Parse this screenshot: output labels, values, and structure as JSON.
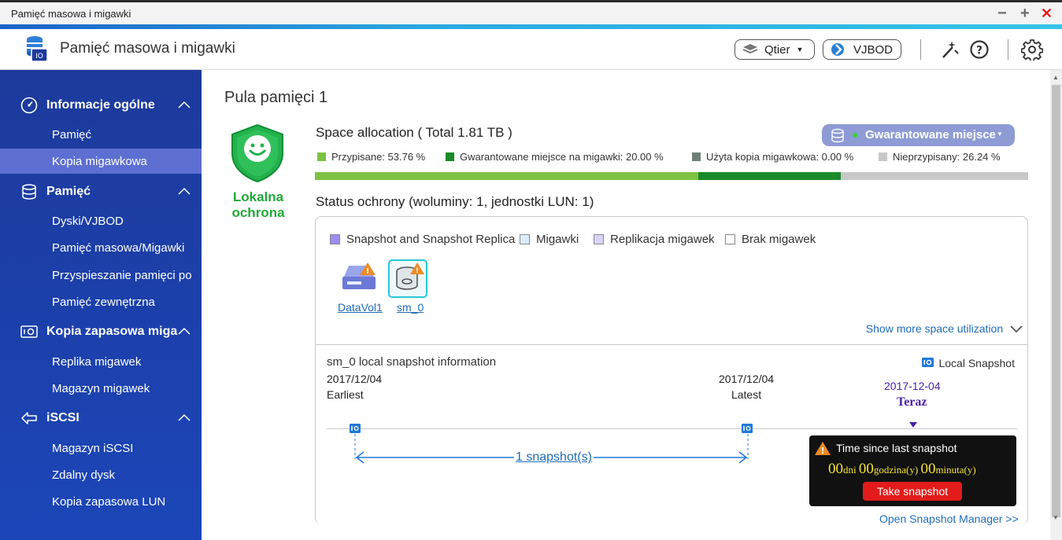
{
  "window": {
    "title": "Pamięć masowa i migawki",
    "controls": {
      "minimize": "−",
      "maximize": "+",
      "close": "✕"
    }
  },
  "header": {
    "app_title": "Pamięć masowa i migawki",
    "qtier_label": "Qtier",
    "vjbod_label": "VJBOD"
  },
  "sidebar": {
    "sections": [
      {
        "label": "Informacje ogólne",
        "items": [
          "Pamięć",
          "Kopia migawkowa"
        ]
      },
      {
        "label": "Pamięć",
        "items": [
          "Dyski/VJBOD",
          "Pamięć masowa/Migawki",
          "Przyspieszanie pamięci po",
          "Pamięć zewnętrzna"
        ]
      },
      {
        "label": "Kopia zapasowa miga",
        "items": [
          "Replika migawek",
          "Magazyn migawek"
        ]
      },
      {
        "label": "iSCSI",
        "items": [
          "Magazyn iSCSI",
          "Zdalny dysk",
          "Kopia zapasowa LUN"
        ]
      }
    ],
    "active_item": "Kopia migawkowa"
  },
  "main": {
    "page_title": "Pula pamięci 1",
    "protection_label_line1": "Lokalna",
    "protection_label_line2": "ochrona",
    "space_title": "Space allocation ( Total 1.81 TB )",
    "guaranteed_button": "Gwarantowane miejsce",
    "allocation_legend": [
      {
        "label": "Przypisane: 53.76 %",
        "value": 53.76,
        "color": "#7dc242"
      },
      {
        "label": "Gwarantowane miejsce na migawki: 20.00 %",
        "value": 20.0,
        "color": "#1b8a2b"
      },
      {
        "label": "Użyta kopia migawkowa: 0.00 %",
        "value": 0.0,
        "color": "#6f8079"
      },
      {
        "label": "Nieprzypisany: 26.24 %",
        "value": 26.24,
        "color": "#c8c8c8"
      }
    ],
    "protection_title": "Status ochrony (woluminy: 1, jednostki LUN: 1)",
    "protection_legend": [
      {
        "label": "Snapshot and Snapshot Replica",
        "color": "#9a8ff0"
      },
      {
        "label": "Migawki",
        "color": "#dcecfb"
      },
      {
        "label": "Replikacja migawek",
        "color": "#d9d3fa"
      },
      {
        "label": "Brak migawek",
        "color": "#ffffff"
      }
    ],
    "volumes": [
      {
        "label": "DataVol1"
      },
      {
        "label": "sm_0"
      }
    ],
    "show_more": "Show more space utilization",
    "snapshot_info_title": "sm_0 local snapshot information",
    "local_snapshot_label": "Local Snapshot",
    "earliest_date": "2017/12/04",
    "earliest_label": "Earliest",
    "latest_date": "2017/12/04",
    "latest_label": "Latest",
    "now_date": "2017-12-04",
    "now_label": "Teraz",
    "snapshot_count": "1 snapshot(s)",
    "tooltip": {
      "title": "Time since last snapshot",
      "days": "00",
      "days_unit": "dni",
      "hours": "00",
      "hours_unit": "godzina(y)",
      "minutes": "00",
      "minutes_unit": "minuta(y)",
      "button": "Take snapshot"
    },
    "open_manager": "Open Snapshot Manager >>"
  }
}
